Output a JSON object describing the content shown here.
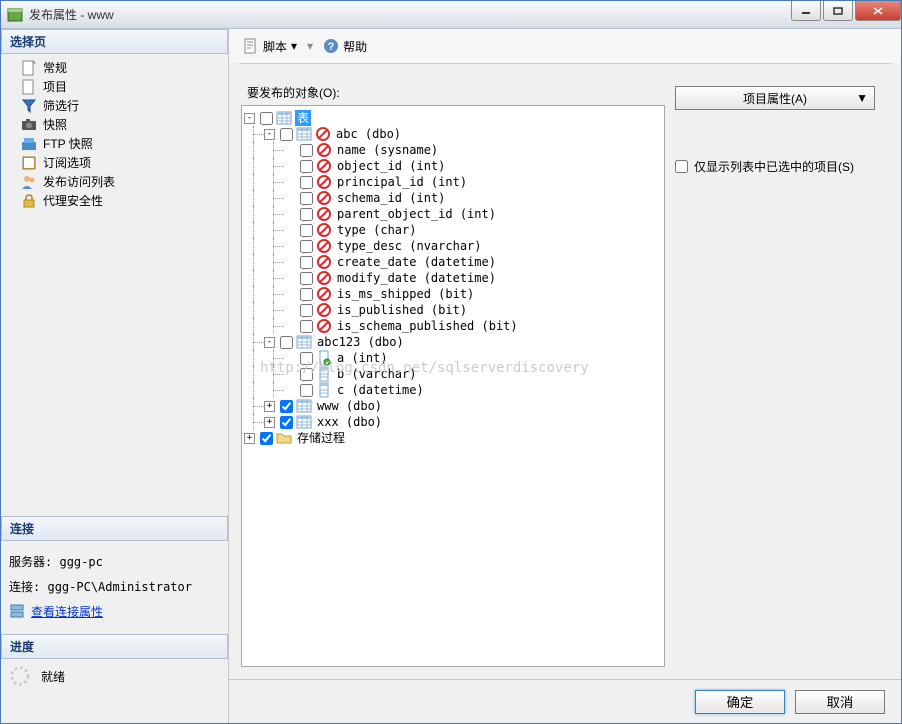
{
  "window": {
    "title": "发布属性 - www"
  },
  "sidebar": {
    "header_select": "选择页",
    "items": [
      {
        "label": "常规"
      },
      {
        "label": "项目"
      },
      {
        "label": "筛选行"
      },
      {
        "label": "快照"
      },
      {
        "label": "FTP 快照"
      },
      {
        "label": "订阅选项"
      },
      {
        "label": "发布访问列表"
      },
      {
        "label": "代理安全性"
      }
    ],
    "header_connection": "连接",
    "server_label": "服务器:",
    "server_value": "ggg-pc",
    "connection_label": "连接:",
    "connection_value": "ggg-PC\\Administrator",
    "view_connection_props": "查看连接属性",
    "header_progress": "进度",
    "progress_status": "就绪"
  },
  "toolbar": {
    "script": "脚本",
    "help": "帮助"
  },
  "main": {
    "objects_label": "要发布的对象(O):",
    "tree": {
      "root": "表",
      "tables": [
        {
          "name": "abc (dbo)",
          "columns": [
            {
              "name": "name (sysname)",
              "blocked": true
            },
            {
              "name": "object_id (int)",
              "blocked": true
            },
            {
              "name": "principal_id (int)",
              "blocked": true
            },
            {
              "name": "schema_id (int)",
              "blocked": true
            },
            {
              "name": "parent_object_id (int)",
              "blocked": true
            },
            {
              "name": "type (char)",
              "blocked": true
            },
            {
              "name": "type_desc (nvarchar)",
              "blocked": true
            },
            {
              "name": "create_date (datetime)",
              "blocked": true
            },
            {
              "name": "modify_date (datetime)",
              "blocked": true
            },
            {
              "name": "is_ms_shipped (bit)",
              "blocked": true
            },
            {
              "name": "is_published (bit)",
              "blocked": true
            },
            {
              "name": "is_schema_published (bit)",
              "blocked": true
            }
          ]
        },
        {
          "name": "abc123 (dbo)",
          "columns": [
            {
              "name": "a (int)",
              "key": true
            },
            {
              "name": "b (varchar)"
            },
            {
              "name": "c (datetime)"
            }
          ]
        },
        {
          "name": "www (dbo)",
          "checked": true,
          "collapsed": true
        },
        {
          "name": "xxx (dbo)",
          "checked": true,
          "collapsed": true
        }
      ],
      "stored_proc": {
        "label": "存储过程",
        "checked": true,
        "collapsed": true
      }
    },
    "article_props_btn": "项目属性(A)",
    "show_only_checked": "仅显示列表中已选中的项目(S)"
  },
  "footer": {
    "ok": "确定",
    "cancel": "取消"
  },
  "watermark": "http://blog.csdn.net/sqlserverdiscovery"
}
